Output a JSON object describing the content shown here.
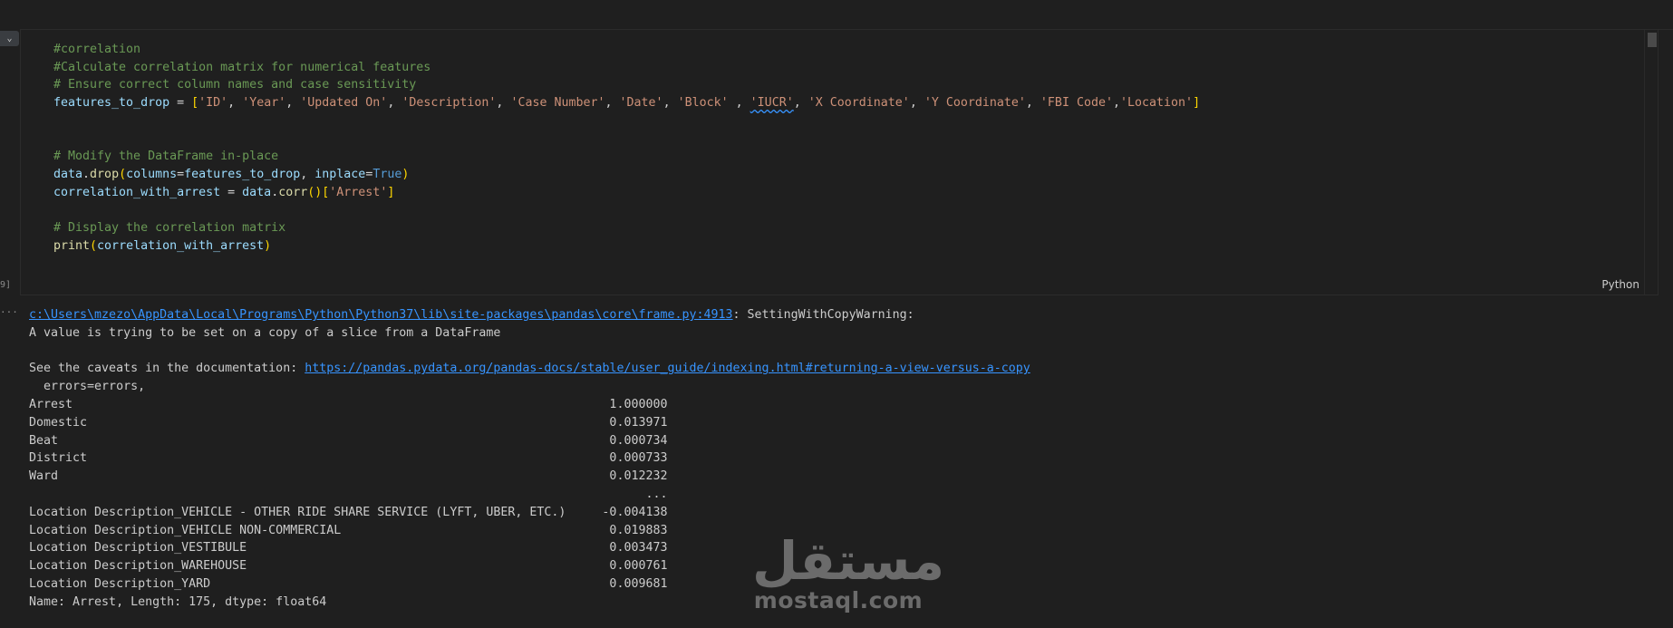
{
  "cell": {
    "language": "Python",
    "execution_label": "9]",
    "gutter_icon": "chevron-down-icon",
    "comment1": "#correlation",
    "comment2": "#Calculate correlation matrix for numerical features",
    "comment3": "# Ensure correct column names and case sensitivity",
    "var_features": "features_to_drop",
    "features": [
      "'ID'",
      "'Year'",
      "'Updated On'",
      "'Description'",
      "'Case Number'",
      "'Date'",
      "'Block'",
      "'IUCR'",
      "'X Coordinate'",
      "'Y Coordinate'",
      "'FBI Code'",
      "'Location'"
    ],
    "comment4": "# Modify the DataFrame in-place",
    "drop_obj": "data",
    "drop_fn": "drop",
    "drop_kw1": "columns",
    "drop_kw2": "inplace",
    "drop_true": "True",
    "var_corr": "correlation_with_arrest",
    "corr_obj": "data",
    "corr_fn": "corr",
    "corr_key": "'Arrest'",
    "comment5": "# Display the correlation matrix",
    "print_fn": "print",
    "print_arg": "correlation_with_arrest"
  },
  "output": {
    "warn_path": "c:\\Users\\mzezo\\AppData\\Local\\Programs\\Python\\Python37\\lib\\site-packages\\pandas\\core\\frame.py:4913",
    "warn_type": ": SettingWithCopyWarning:",
    "warn_line2": "A value is trying to be set on a copy of a slice from a DataFrame",
    "caveats_prefix": "See the caveats in the documentation: ",
    "caveats_url": "https://pandas.pydata.org/pandas-docs/stable/user_guide/indexing.html#returning-a-view-versus-a-copy",
    "errors_line": "  errors=errors,",
    "rows": [
      {
        "label": "Arrest",
        "value": "1.000000"
      },
      {
        "label": "Domestic",
        "value": "0.013971"
      },
      {
        "label": "Beat",
        "value": "0.000734"
      },
      {
        "label": "District",
        "value": "0.000733"
      },
      {
        "label": "Ward",
        "value": "0.012232"
      },
      {
        "label": "",
        "value": "..."
      },
      {
        "label": "Location Description_VEHICLE - OTHER RIDE SHARE SERVICE (LYFT, UBER, ETC.)",
        "value": "-0.004138"
      },
      {
        "label": "Location Description_VEHICLE NON-COMMERCIAL",
        "value": "0.019883"
      },
      {
        "label": "Location Description_VESTIBULE",
        "value": "0.003473"
      },
      {
        "label": "Location Description_WAREHOUSE",
        "value": "0.000761"
      },
      {
        "label": "Location Description_YARD",
        "value": "0.009681"
      }
    ],
    "footer": "Name: Arrest, Length: 175, dtype: float64"
  },
  "watermark": {
    "arabic": "مستقل",
    "latin": "mostaql.com"
  }
}
